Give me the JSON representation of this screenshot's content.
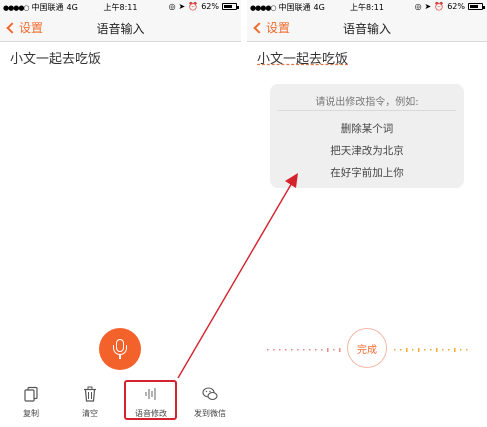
{
  "statusbar": {
    "carrier": "中国联通",
    "network": "4G",
    "time": "上午8:11",
    "battery": "62%"
  },
  "left": {
    "nav": {
      "back_label": "设置",
      "title": "语音输入"
    },
    "content_text": "小文一起去吃饭",
    "toolbar": [
      {
        "label": "复制",
        "icon": "copy-icon"
      },
      {
        "label": "清空",
        "icon": "trash-icon"
      },
      {
        "label": "语音修改",
        "icon": "voice-edit-icon"
      },
      {
        "label": "发到微信",
        "icon": "wechat-icon"
      }
    ]
  },
  "right": {
    "nav": {
      "back_label": "设置",
      "title": "语音输入"
    },
    "content_text": "小文一起去吃饭",
    "hint": {
      "title": "请说出修改指令，例如:",
      "items": [
        "删除某个词",
        "把天津改为北京",
        "在好字前加上你"
      ]
    },
    "done_label": "完成"
  },
  "colors": {
    "accent": "#f06a2b",
    "mic": "#f4622b",
    "highlight": "#d5232e"
  }
}
